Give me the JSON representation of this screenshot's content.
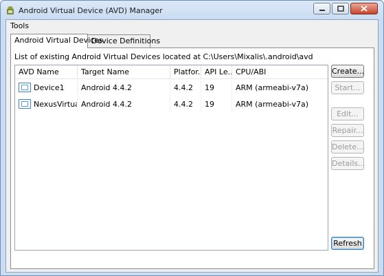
{
  "window": {
    "title": "Android Virtual Device (AVD) Manager"
  },
  "menu": {
    "items": [
      "Tools"
    ]
  },
  "tabs": [
    {
      "label": "Android Virtual Devices"
    },
    {
      "label": "Device Definitions"
    }
  ],
  "panel": {
    "caption": "List of existing Android Virtual Devices located at C:\\Users\\Mixalis\\.android\\avd"
  },
  "table": {
    "headers": [
      "AVD Name",
      "Target Name",
      "Platfor...",
      "API Le...",
      "CPU/ABI"
    ],
    "rows": [
      {
        "name": "Device1",
        "target": "Android 4.4.2",
        "platform": "4.4.2",
        "api": "19",
        "cpu": "ARM (armeabi-v7a)"
      },
      {
        "name": "NexusVirtua...",
        "target": "Android 4.4.2",
        "platform": "4.4.2",
        "api": "19",
        "cpu": "ARM (armeabi-v7a)"
      }
    ]
  },
  "buttons": {
    "create": "Create...",
    "start": "Start...",
    "edit": "Edit...",
    "repair": "Repair...",
    "delete": "Delete...",
    "details": "Details...",
    "refresh": "Refresh"
  },
  "icons": {
    "app": "android-icon",
    "avd": "device-icon"
  }
}
